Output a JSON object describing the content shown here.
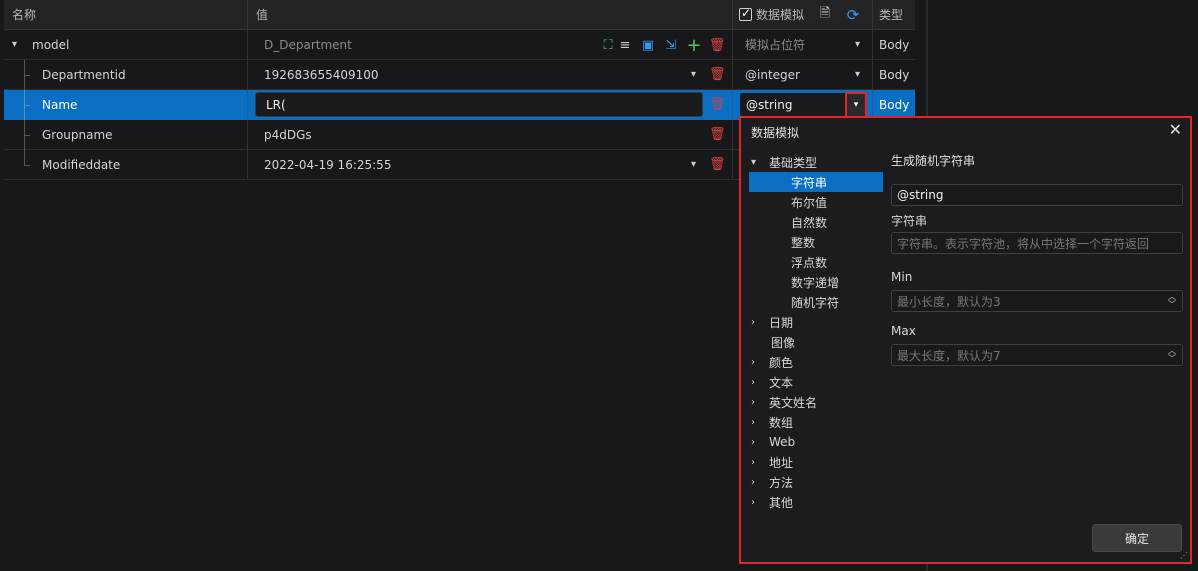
{
  "columns": {
    "name": "名称",
    "value": "值",
    "mock": "数据模拟",
    "type": "类型"
  },
  "rows": [
    {
      "name": "model",
      "value": "D_Department",
      "mock": "模拟占位符",
      "type": "Body"
    },
    {
      "name": "Departmentid",
      "value": "192683655409100",
      "mock": "@integer",
      "type": "Body"
    },
    {
      "name": "Name",
      "value": "LR(",
      "mock": "@string",
      "type": "Body"
    },
    {
      "name": "Groupname",
      "value": "p4dDGs",
      "mock": "",
      "type": ""
    },
    {
      "name": "Modifieddate",
      "value": "2022-04-19 16:25:55",
      "mock": "",
      "type": ""
    }
  ],
  "panel": {
    "title": "数据模拟",
    "tree": [
      {
        "label": "基础类型",
        "expanded": true
      },
      {
        "label": "字符串",
        "active": true
      },
      {
        "label": "布尔值"
      },
      {
        "label": "自然数"
      },
      {
        "label": "整数"
      },
      {
        "label": "浮点数"
      },
      {
        "label": "数字递增"
      },
      {
        "label": "随机字符"
      },
      {
        "label": "日期"
      },
      {
        "label": "图像"
      },
      {
        "label": "颜色"
      },
      {
        "label": "文本"
      },
      {
        "label": "英文姓名"
      },
      {
        "label": "数组"
      },
      {
        "label": "Web"
      },
      {
        "label": "地址"
      },
      {
        "label": "方法"
      },
      {
        "label": "其他"
      }
    ],
    "form": {
      "heading": "生成随机字符串",
      "value": "@string",
      "label_chars": "字符串",
      "placeholder_chars": "字符串。表示字符池，将从中选择一个字符返回",
      "label_min": "Min",
      "placeholder_min": "最小长度，默认为3",
      "label_max": "Max",
      "placeholder_max": "最大长度，默认为7"
    },
    "confirm": "确定"
  },
  "colors": {
    "accent": "#0a6fc2",
    "danger": "#e0262d",
    "bg": "#18181a"
  }
}
